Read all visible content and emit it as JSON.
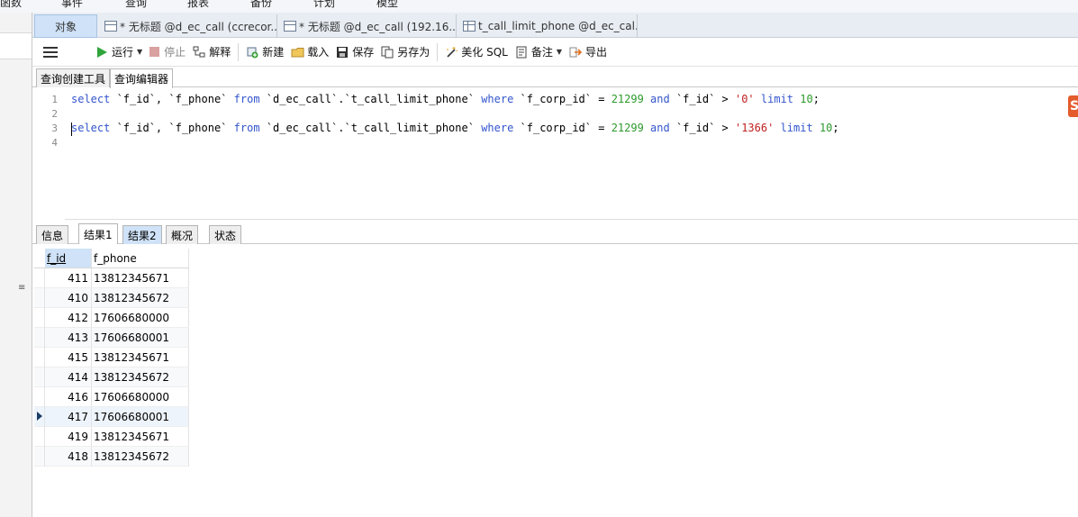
{
  "menubar": {
    "items": [
      "函数",
      "事件",
      "查询",
      "报表",
      "备份",
      "计划",
      "模型"
    ]
  },
  "tabs": [
    {
      "label": "对象",
      "active": true
    },
    {
      "label": "* 无标题 @d_ec_call (ccrecor..."
    },
    {
      "label": "* 无标题 @d_ec_call (192.16..."
    },
    {
      "label": "t_call_limit_phone @d_ec_cal..."
    }
  ],
  "toolbar": {
    "run": "运行",
    "stop": "停止",
    "explain": "解释",
    "new": "新建",
    "load": "载入",
    "save": "保存",
    "save_as": "另存为",
    "beautify": "美化 SQL",
    "note": "备注",
    "export": "导出"
  },
  "subtabs": [
    "查询创建工具",
    "查询编辑器"
  ],
  "editor": {
    "line_numbers": [
      "1",
      "2",
      "3",
      "4"
    ],
    "line1": {
      "kw1": "select",
      "t1": " `f_id`, `f_phone` ",
      "kw2": "from",
      "t2": " `d_ec_call`.`t_call_limit_phone` ",
      "kw3": "where",
      "t3": " `f_corp_id` = ",
      "n1": "21299",
      "t4": " ",
      "kw4": "and",
      "t5": " `f_id` > ",
      "s1": "'0'",
      "t6": " ",
      "kw5": "limit",
      "t7": " ",
      "n2": "10",
      "t8": ";"
    },
    "line3": {
      "kw1": "select",
      "t1": " `f_id`, `f_phone` ",
      "kw2": "from",
      "t2": " `d_ec_call`.`t_call_limit_phone` ",
      "kw3": "where",
      "t3": " `f_corp_id` = ",
      "n1": "21299",
      "t4": " ",
      "kw4": "and",
      "t5": " `f_id` > ",
      "s1": "'1366'",
      "t6": " ",
      "kw5": "limit",
      "t7": " ",
      "n2": "10",
      "t8": ";"
    }
  },
  "logo_text": "S",
  "result_tabs": [
    "信息",
    "结果1",
    "结果2",
    "概况",
    "状态"
  ],
  "grid": {
    "columns": [
      "f_id",
      "f_phone"
    ],
    "rows": [
      [
        "411",
        "13812345671"
      ],
      [
        "410",
        "13812345672"
      ],
      [
        "412",
        "17606680000"
      ],
      [
        "413",
        "17606680001"
      ],
      [
        "415",
        "13812345671"
      ],
      [
        "414",
        "13812345672"
      ],
      [
        "416",
        "17606680000"
      ],
      [
        "417",
        "17606680001"
      ],
      [
        "419",
        "13812345671"
      ],
      [
        "418",
        "13812345672"
      ]
    ],
    "selected_row": 7
  }
}
